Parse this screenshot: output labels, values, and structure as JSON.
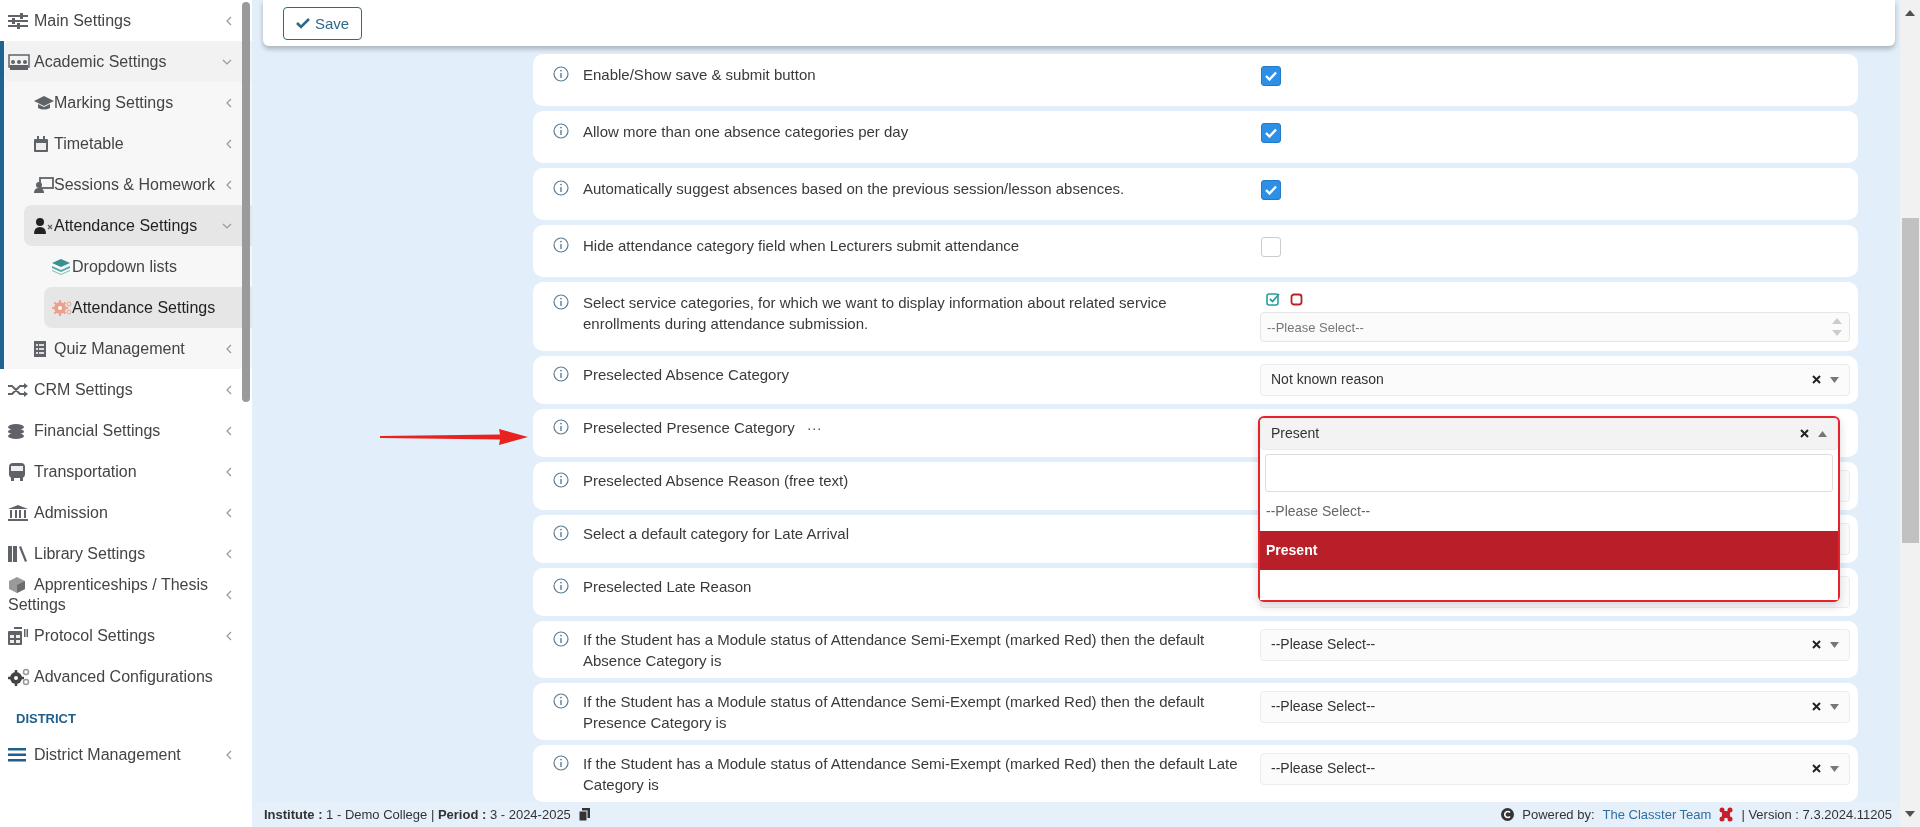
{
  "sidebar": {
    "sections": [
      {
        "items": [
          {
            "label": "Main Settings",
            "kind": "group",
            "expanded": false
          },
          {
            "label": "Academic Settings",
            "kind": "group",
            "expanded": true,
            "children": [
              {
                "label": "Marking Settings",
                "kind": "group",
                "expanded": false
              },
              {
                "label": "Timetable",
                "kind": "group",
                "expanded": false
              },
              {
                "label": "Sessions & Homework",
                "kind": "group",
                "expanded": false
              },
              {
                "label": "Attendance Settings",
                "kind": "group",
                "expanded": true,
                "children": [
                  {
                    "label": "Dropdown lists",
                    "selected": false
                  },
                  {
                    "label": "Attendance Settings",
                    "selected": true
                  }
                ]
              },
              {
                "label": "Quiz Management",
                "kind": "group",
                "expanded": false
              }
            ]
          },
          {
            "label": "CRM Settings",
            "kind": "group",
            "expanded": false
          },
          {
            "label": "Financial Settings",
            "kind": "group",
            "expanded": false
          },
          {
            "label": "Transportation",
            "kind": "group",
            "expanded": false
          },
          {
            "label": "Admission",
            "kind": "group",
            "expanded": false
          },
          {
            "label": "Library Settings",
            "kind": "group",
            "expanded": false
          },
          {
            "label": "Apprenticeships / Thesis Settings",
            "kind": "group",
            "expanded": false
          },
          {
            "label": "Protocol Settings",
            "kind": "group",
            "expanded": false
          },
          {
            "label": "Advanced Configurations",
            "selected": false
          }
        ]
      },
      {
        "title": "DISTRICT",
        "items": [
          {
            "label": "District Management",
            "kind": "group",
            "expanded": false
          }
        ]
      }
    ]
  },
  "toolbar": {
    "save_label": "Save"
  },
  "settings": [
    {
      "label": "Enable/Show save & submit button",
      "control": {
        "kind": "checkbox",
        "checked": true
      }
    },
    {
      "label": "Allow more than one absence categories per day",
      "control": {
        "kind": "checkbox",
        "checked": true
      }
    },
    {
      "label": "Automatically suggest absences based on the previous session/lesson absences.",
      "control": {
        "kind": "checkbox",
        "checked": true
      }
    },
    {
      "label": "Hide attendance category field when Lecturers submit attendance",
      "control": {
        "kind": "checkbox",
        "checked": false
      }
    },
    {
      "label": "Select service categories, for which we want to display information about related service enrollments during attendance submission.",
      "control": {
        "kind": "multiselect",
        "placeholder": "--Please Select--"
      }
    },
    {
      "label": "Preselected Absence Category",
      "control": {
        "kind": "select",
        "value": "Not known reason",
        "clearable": true,
        "open": false
      }
    },
    {
      "label": "Preselected Presence Category",
      "more": "···",
      "control": {
        "kind": "select",
        "value": "Present",
        "clearable": true,
        "open": true,
        "options": [
          {
            "label": "--Please Select--",
            "selected": false
          },
          {
            "label": "Present",
            "selected": true
          }
        ]
      }
    },
    {
      "label": "Preselected Absence Reason (free text)",
      "control": {
        "kind": "select",
        "open": false
      }
    },
    {
      "label": "Select a default category for Late Arrival",
      "control": {
        "kind": "select",
        "open": false
      }
    },
    {
      "label": "Preselected Late Reason",
      "control": {
        "kind": "select",
        "open": false
      }
    },
    {
      "label": "If the Student has a Module status of Attendance Semi-Exempt (marked Red) then the default Absence Category is",
      "control": {
        "kind": "select",
        "value": "--Please Select--",
        "clearable": true,
        "open": false
      }
    },
    {
      "label": "If the Student has a Module status of Attendance Semi-Exempt (marked Red) then the default Presence Category is",
      "control": {
        "kind": "select",
        "value": "--Please Select--",
        "clearable": true,
        "open": false
      }
    },
    {
      "label": "If the Student has a Module status of Attendance Semi-Exempt (marked Red) then the default Late Category is",
      "control": {
        "kind": "select",
        "value": "--Please Select--",
        "clearable": true,
        "open": false
      }
    }
  ],
  "footer": {
    "context": "**Institute :** 1 - Demo College | **Period :** 3 - 2024-2025",
    "powered_label": "Powered by:",
    "link": "The Classter Team",
    "version": "| Version : 7.3.2024.11205"
  }
}
